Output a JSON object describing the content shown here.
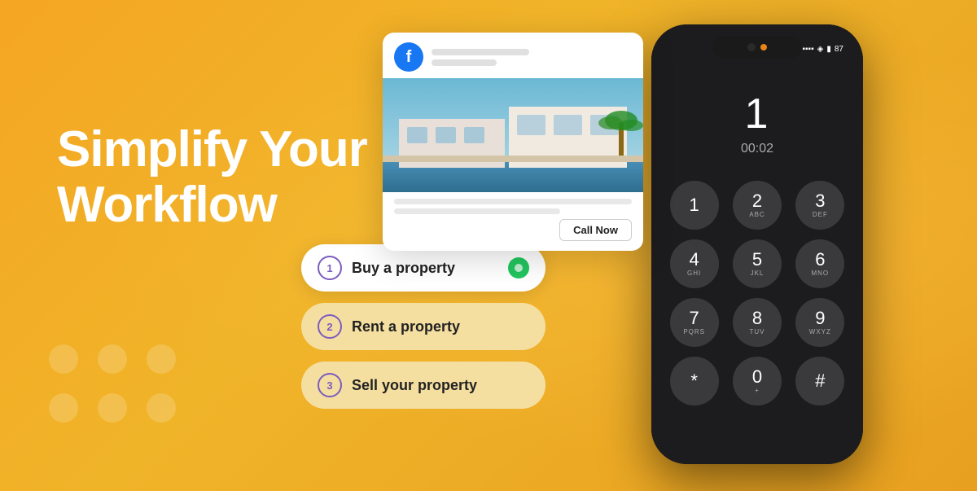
{
  "hero": {
    "title_line1": "Simplify Your",
    "title_line2": "Workflow"
  },
  "options": [
    {
      "number": "1",
      "label": "Buy a property",
      "active": true
    },
    {
      "number": "2",
      "label": "Rent a property",
      "active": false
    },
    {
      "number": "3",
      "label": "Sell your property",
      "active": false
    }
  ],
  "fb_card": {
    "call_now_label": "Call Now"
  },
  "phone": {
    "caller": "1",
    "duration": "00:02",
    "keys": [
      {
        "num": "1",
        "alpha": ""
      },
      {
        "num": "2",
        "alpha": "ABC"
      },
      {
        "num": "3",
        "alpha": "DEF"
      },
      {
        "num": "4",
        "alpha": "GHI"
      },
      {
        "num": "5",
        "alpha": "JKL"
      },
      {
        "num": "6",
        "alpha": "MNO"
      },
      {
        "num": "7",
        "alpha": "PQRS"
      },
      {
        "num": "8",
        "alpha": "TUV"
      },
      {
        "num": "9",
        "alpha": "WXYZ"
      },
      {
        "num": "*",
        "alpha": ""
      },
      {
        "num": "0",
        "alpha": "+"
      },
      {
        "num": "#",
        "alpha": ""
      }
    ],
    "battery": "87"
  }
}
